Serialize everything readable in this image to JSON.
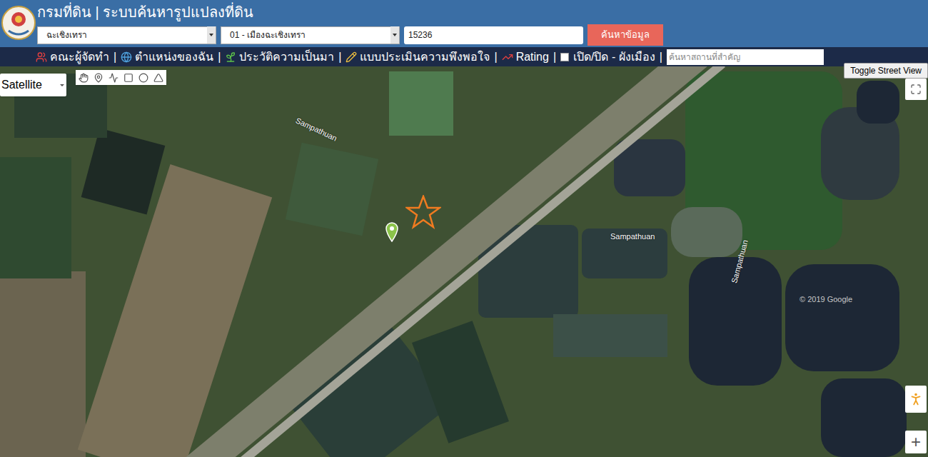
{
  "header": {
    "title": "กรมที่ดิน | ระบบค้นหารูปแปลงที่ดิน",
    "province": "ฉะเชิงเทรา",
    "district": "01 - เมืองฉะเชิงเทรา",
    "parcel_number": "15236",
    "search_button": "ค้นหาข้อมูล"
  },
  "menu": {
    "items": [
      {
        "label": "คณะผู้จัดทำ"
      },
      {
        "label": "ตำแหน่งของฉัน"
      },
      {
        "label": "ประวัติความเป็นมา"
      },
      {
        "label": "แบบประเมินความพึงพอใจ"
      },
      {
        "label": "Rating"
      }
    ],
    "separator": "|",
    "city_plan": {
      "label": "เปิด/ปิด - ผังเมือง",
      "checked": false
    },
    "search": {
      "placeholder": "ค้นหาสถานที่สำคัญ"
    }
  },
  "map": {
    "type": "Satellite",
    "street_view_button": "Toggle Street View",
    "labels": [
      "Sampathuan",
      "Sampathuan",
      "Sampathuan"
    ],
    "watermark": "© 2019 Google",
    "zoom_in": "+"
  }
}
